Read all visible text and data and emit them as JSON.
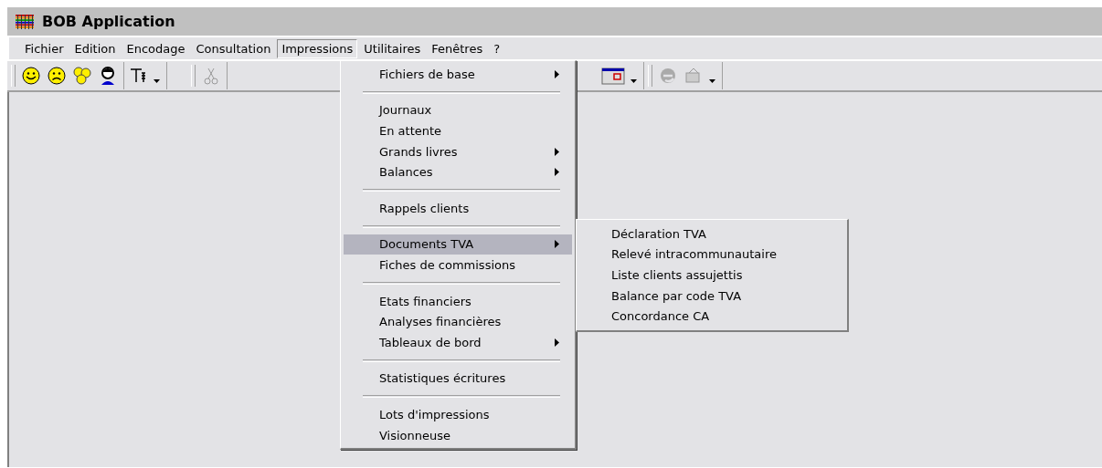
{
  "window": {
    "title": "BOB Application"
  },
  "menubar": [
    {
      "label": "Fichier",
      "selected": false
    },
    {
      "label": "Edition",
      "selected": false
    },
    {
      "label": "Encodage",
      "selected": false
    },
    {
      "label": "Consultation",
      "selected": false
    },
    {
      "label": "Impressions",
      "selected": true
    },
    {
      "label": "Utilitaires",
      "selected": false
    },
    {
      "label": "Fenêtres",
      "selected": false
    },
    {
      "label": "?",
      "selected": false
    }
  ],
  "menu": [
    {
      "kind": "item",
      "label": "Fichiers de base",
      "submenu": true,
      "selected": false
    },
    {
      "kind": "separator"
    },
    {
      "kind": "item",
      "label": "Journaux",
      "submenu": false,
      "selected": false
    },
    {
      "kind": "item",
      "label": "En attente",
      "submenu": false,
      "selected": false
    },
    {
      "kind": "item",
      "label": "Grands livres",
      "submenu": true,
      "selected": false
    },
    {
      "kind": "item",
      "label": "Balances",
      "submenu": true,
      "selected": false
    },
    {
      "kind": "separator"
    },
    {
      "kind": "item",
      "label": "Rappels clients",
      "submenu": false,
      "selected": false
    },
    {
      "kind": "separator"
    },
    {
      "kind": "item",
      "label": "Documents TVA",
      "submenu": true,
      "selected": true
    },
    {
      "kind": "item",
      "label": "Fiches de commissions",
      "submenu": false,
      "selected": false
    },
    {
      "kind": "separator"
    },
    {
      "kind": "item",
      "label": "Etats financiers",
      "submenu": false,
      "selected": false
    },
    {
      "kind": "item",
      "label": "Analyses financières",
      "submenu": false,
      "selected": false
    },
    {
      "kind": "item",
      "label": "Tableaux de bord",
      "submenu": true,
      "selected": false
    },
    {
      "kind": "separator"
    },
    {
      "kind": "item",
      "label": "Statistiques écritures",
      "submenu": false,
      "selected": false
    },
    {
      "kind": "separator"
    },
    {
      "kind": "item",
      "label": "Lots d'impressions",
      "submenu": false,
      "selected": false
    },
    {
      "kind": "item",
      "label": "Visionneuse",
      "submenu": false,
      "selected": false
    }
  ],
  "submenu": [
    {
      "label": "Déclaration TVA"
    },
    {
      "label": "Relevé intracommunautaire"
    },
    {
      "label": "Liste clients assujettis"
    },
    {
      "label": "Balance par code TVA"
    },
    {
      "label": "Concordance CA"
    }
  ]
}
